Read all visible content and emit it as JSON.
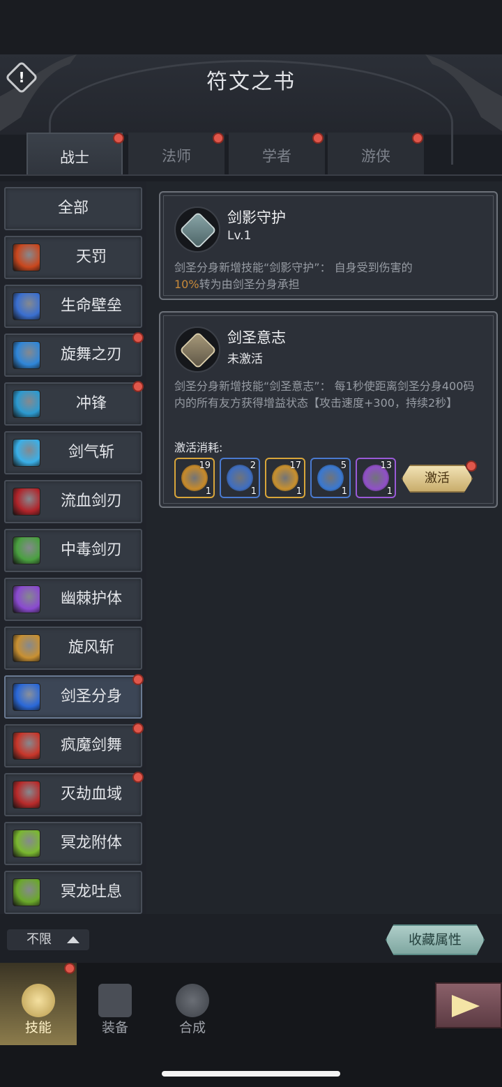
{
  "header": {
    "title": "符文之书"
  },
  "tabs": [
    {
      "label": "战士",
      "active": true,
      "badge": true
    },
    {
      "label": "法师",
      "active": false,
      "badge": true
    },
    {
      "label": "学者",
      "active": false,
      "badge": true
    },
    {
      "label": "游侠",
      "active": false,
      "badge": true
    }
  ],
  "sidebar": {
    "items": [
      {
        "label": "全部",
        "icon": "all",
        "badge": false
      },
      {
        "label": "天罚",
        "icon": "heavenly-punishment-icon",
        "badge": false,
        "color": "#c9471e"
      },
      {
        "label": "生命壁垒",
        "icon": "life-barrier-icon",
        "badge": false,
        "color": "#3a6fd0"
      },
      {
        "label": "旋舞之刃",
        "icon": "whirling-blade-icon",
        "badge": true,
        "color": "#2f86d8"
      },
      {
        "label": "冲锋",
        "icon": "charge-icon",
        "badge": true,
        "color": "#2c9ad0"
      },
      {
        "label": "剑气斩",
        "icon": "sword-qi-slash-icon",
        "badge": false,
        "color": "#3ab0e8"
      },
      {
        "label": "流血剑刃",
        "icon": "bleeding-blade-icon",
        "badge": false,
        "color": "#b0242a"
      },
      {
        "label": "中毒剑刃",
        "icon": "poison-blade-icon",
        "badge": false,
        "color": "#4aa040"
      },
      {
        "label": "幽棘护体",
        "icon": "shadow-thorn-icon",
        "badge": false,
        "color": "#8a4ad0"
      },
      {
        "label": "旋风斩",
        "icon": "whirlwind-slash-icon",
        "badge": false,
        "color": "#c89032"
      },
      {
        "label": "剑圣分身",
        "icon": "blademaster-clone-icon",
        "badge": true,
        "color": "#2a68d8",
        "selected": true
      },
      {
        "label": "疯魔剑舞",
        "icon": "frenzy-sword-dance-icon",
        "badge": true,
        "color": "#c8362a"
      },
      {
        "label": "灭劫血域",
        "icon": "blood-domain-icon",
        "badge": true,
        "color": "#b82a2a"
      },
      {
        "label": "冥龙附体",
        "icon": "nether-dragon-icon",
        "badge": false,
        "color": "#7ab830"
      },
      {
        "label": "冥龙吐息",
        "icon": "dragon-breath-icon",
        "badge": false,
        "color": "#6aa82a"
      }
    ]
  },
  "cards": [
    {
      "name": "剑影守护",
      "level": "Lv.1",
      "icon": "sword-shadow-rune-icon",
      "desc_before": "剑圣分身新增技能“剑影守护”： 自身受到伤害的",
      "desc_highlight": "10%",
      "desc_after": "转为由剑圣分身承担"
    },
    {
      "name": "剑圣意志",
      "level": "未激活",
      "icon": "blademaster-will-rune-icon",
      "desc": "剑圣分身新增技能“剑圣意志”： 每1秒使距离剑圣分身400码内的所有友方获得增益状态【攻击速度+300，持续2秒】",
      "cost_label": "激活消耗:",
      "materials": [
        {
          "have": "19",
          "need": "1",
          "icon": "golden-swirl-stone-icon",
          "border": "#d9a63a",
          "gem": "#c78a2a"
        },
        {
          "have": "2",
          "need": "1",
          "icon": "blue-wave-stone-icon",
          "border": "#4a7ad0",
          "gem": "#3f6ec0"
        },
        {
          "have": "17",
          "need": "1",
          "icon": "lightning-stone-icon",
          "border": "#d9a63a",
          "gem": "#c8902e"
        },
        {
          "have": "5",
          "need": "1",
          "icon": "blue-figure-stone-icon",
          "border": "#4a7ad0",
          "gem": "#3a78d0"
        },
        {
          "have": "13",
          "need": "1",
          "icon": "purple-wing-stone-icon",
          "border": "#9a5ad8",
          "gem": "#9050c8"
        }
      ],
      "activate_label": "激活"
    }
  ],
  "footer": {
    "filter_label": "不限",
    "favorite_label": "收藏属性"
  },
  "nav": [
    {
      "label": "技能",
      "icon": "sword-icon",
      "active": true,
      "badge": true
    },
    {
      "label": "装备",
      "icon": "scroll-icon",
      "active": false,
      "badge": false
    },
    {
      "label": "合成",
      "icon": "forge-icon",
      "active": false,
      "badge": false
    }
  ],
  "colors": {
    "badge": "#e0574b",
    "highlight": "#c98a3a",
    "accent_gold": "#f1e2b4"
  }
}
